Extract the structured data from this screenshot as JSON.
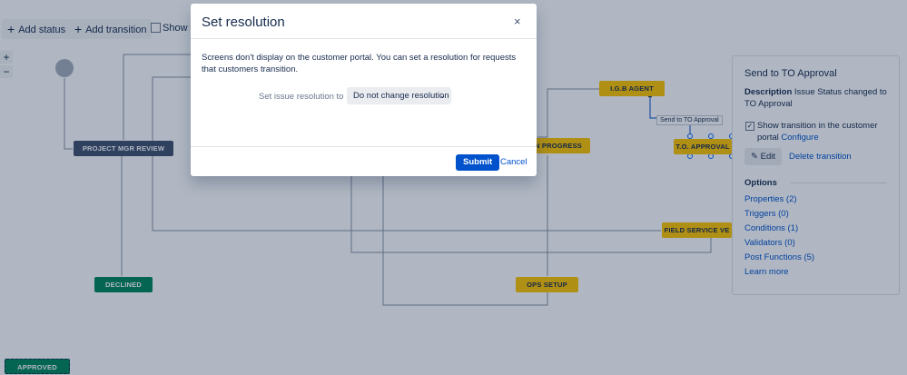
{
  "toolbar": {
    "add_status": "Add status",
    "add_transition": "Add transition",
    "show_transition": "Show tra"
  },
  "zoom": {
    "in": "+",
    "out": "−"
  },
  "diagram": {
    "nodes": {
      "project_mgr_review": "PROJECT MGR REVIEW",
      "declined": "DECLINED",
      "approved": "APPROVED",
      "igb_agent": "I.G.B AGENT",
      "in_progress": "N PROGRESS",
      "to_approval": "T.O. APPROVAL",
      "field_service": "FIELD SERVICE VE",
      "ops_setup": "OPS SETUP"
    },
    "transition_label": "Send to TO Approval"
  },
  "panel": {
    "title": "Send to TO Approval",
    "description_label": "Description",
    "description_text": "Issue Status changed to TO Approval",
    "show_transition_label": "Show transition in the customer portal",
    "configure_link": "Configure",
    "edit_label": "Edit",
    "delete_label": "Delete transition",
    "options_title": "Options",
    "options": [
      "Properties (2)",
      "Triggers (0)",
      "Conditions (1)",
      "Validators (0)",
      "Post Functions (5)",
      "Learn more"
    ]
  },
  "modal": {
    "title": "Set resolution",
    "close": "×",
    "text": "Screens don't display on the customer portal. You can set a resolution for requests that customers transition.",
    "resolution_label": "Set issue resolution to",
    "resolution_value": "Do not change resolution",
    "submit": "Submit",
    "cancel": "Cancel"
  }
}
